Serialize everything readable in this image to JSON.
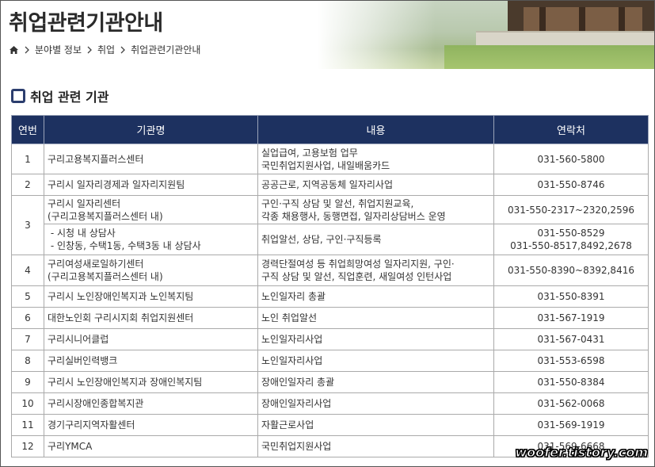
{
  "header": {
    "title": "취업관련기관안내",
    "breadcrumb": [
      "분야별 정보",
      "취업",
      "취업관련기관안내"
    ]
  },
  "section": {
    "title": "취업 관련 기관"
  },
  "table": {
    "columns": [
      "연번",
      "기관명",
      "내용",
      "연락처"
    ],
    "rows": [
      {
        "no": "1",
        "org": [
          "구리고용복지플러스센터"
        ],
        "desc": [
          "실업급여, 고용보험 업무",
          "국민취업지원사업, 내일배움카드"
        ],
        "tel": [
          "031-560-5800"
        ]
      },
      {
        "no": "2",
        "org": [
          "구리시 일자리경제과 일자리지원팀"
        ],
        "desc": [
          "공공근로, 지역공동체 일자리사업"
        ],
        "tel": [
          "031-550-8746"
        ]
      },
      {
        "no": "3",
        "org": [
          "구리시 일자리센터",
          "(구리고용복지플러스센터 내)"
        ],
        "desc": [
          "구인·구직 상담 및 알선, 취업지원교육,",
          "각종 채용행사, 동행면접, 일자리상담버스 운영"
        ],
        "tel": [
          "031-550-2317~2320,2596"
        ]
      },
      {
        "no": "",
        "org": [
          " - 시청 내 상담사",
          " - 인창동, 수택1동, 수택3동 내 상담사"
        ],
        "desc": [
          "취업알선, 상담, 구인·구직등록"
        ],
        "tel": [
          "031-550-8529",
          "031-550-8517,8492,2678"
        ]
      },
      {
        "no": "4",
        "org": [
          "구리여성새로일하기센터",
          "(구리고용복지플러스센터 내)"
        ],
        "desc": [
          "경력단절여성 등 취업희망여성 일자리지원, 구인·",
          "구직 상담 및 알선, 직업훈련, 새일여성 인턴사업"
        ],
        "tel": [
          "031-550-8390~8392,8416"
        ]
      },
      {
        "no": "5",
        "org": [
          "구리시 노인장애인복지과 노인복지팀"
        ],
        "desc": [
          "노인일자리 총괄"
        ],
        "tel": [
          "031-550-8391"
        ]
      },
      {
        "no": "6",
        "org": [
          "대한노인회 구리시지회 취업지원센터"
        ],
        "desc": [
          "노인 취업알선"
        ],
        "tel": [
          "031-567-1919"
        ]
      },
      {
        "no": "7",
        "org": [
          "구리시니어클럽"
        ],
        "desc": [
          "노인일자리사업"
        ],
        "tel": [
          "031-567-0431"
        ]
      },
      {
        "no": "8",
        "org": [
          "구리실버인력뱅크"
        ],
        "desc": [
          "노인일자리사업"
        ],
        "tel": [
          "031-553-6598"
        ]
      },
      {
        "no": "9",
        "org": [
          "구리시 노인장애인복지과 장애인복지팀"
        ],
        "desc": [
          "장애인일자리 총괄"
        ],
        "tel": [
          "031-550-8384"
        ]
      },
      {
        "no": "10",
        "org": [
          "구리시장애인종합복지관"
        ],
        "desc": [
          "장애인일자리사업"
        ],
        "tel": [
          "031-562-0068"
        ]
      },
      {
        "no": "11",
        "org": [
          "경기구리지역자활센터"
        ],
        "desc": [
          "자활근로사업"
        ],
        "tel": [
          "031-569-1919"
        ]
      },
      {
        "no": "12",
        "org": [
          "구리YMCA"
        ],
        "desc": [
          "국민취업지원사업"
        ],
        "tel": [
          "031-569-6668"
        ]
      }
    ]
  },
  "watermark": "woofer.tistory.com",
  "colors": {
    "header_bg": "#1d3160",
    "icon": "#2c3e6e"
  }
}
